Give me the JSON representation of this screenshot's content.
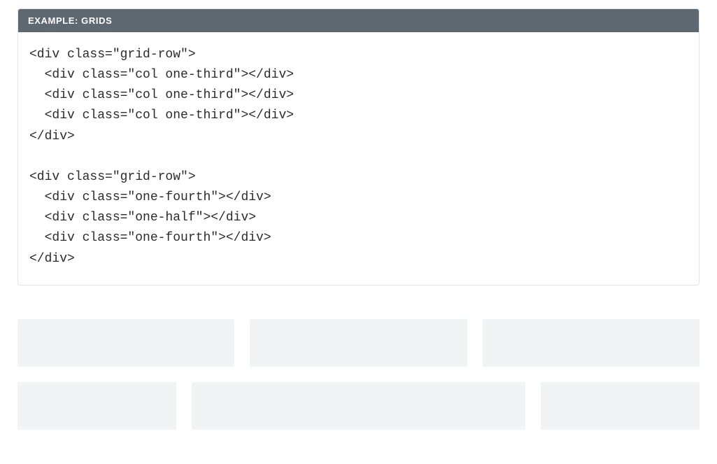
{
  "example": {
    "header": "EXAMPLE: GRIDS",
    "code": "<div class=\"grid-row\">\n  <div class=\"col one-third\"></div>\n  <div class=\"col one-third\"></div>\n  <div class=\"col one-third\"></div>\n</div>\n\n<div class=\"grid-row\">\n  <div class=\"one-fourth\"></div>\n  <div class=\"one-half\"></div>\n  <div class=\"one-fourth\"></div>\n</div>"
  },
  "grid_rows": [
    {
      "columns": [
        "one-third",
        "one-third",
        "one-third"
      ]
    },
    {
      "columns": [
        "one-fourth",
        "one-half",
        "one-fourth"
      ]
    }
  ]
}
